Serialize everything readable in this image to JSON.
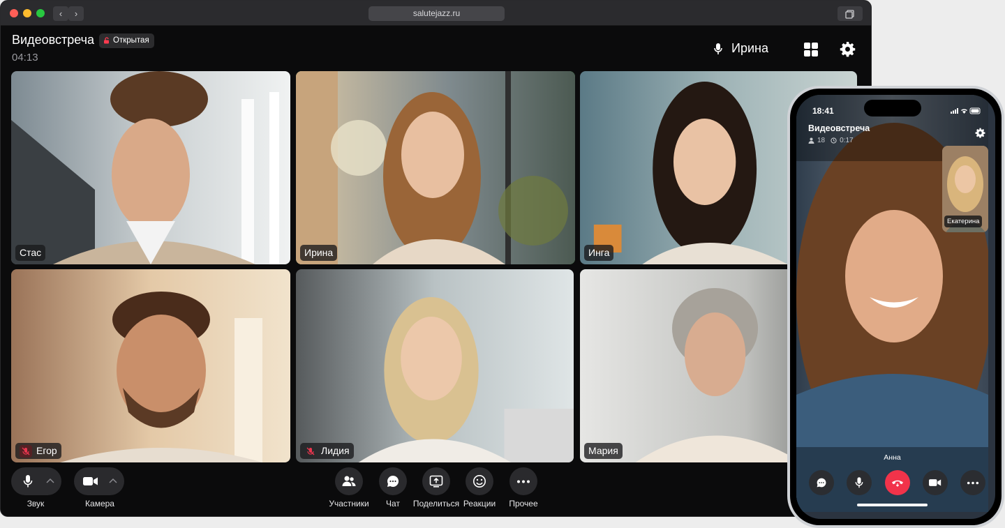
{
  "browser": {
    "url": "salutejazz.ru"
  },
  "meeting": {
    "title": "Видеовстреча",
    "access_badge": "Открытая",
    "timer": "04:13",
    "current_speaker": "Ирина"
  },
  "participants": [
    {
      "name": "Стас",
      "muted": false,
      "active": false
    },
    {
      "name": "Ирина",
      "muted": false,
      "active": true
    },
    {
      "name": "Инга",
      "muted": false,
      "active": false
    },
    {
      "name": "Егор",
      "muted": true,
      "active": false
    },
    {
      "name": "Лидия",
      "muted": true,
      "active": false
    },
    {
      "name": "Мария",
      "muted": false,
      "active": false
    }
  ],
  "toolbar": {
    "sound_label": "Звук",
    "camera_label": "Камера",
    "participants_label": "Участники",
    "chat_label": "Чат",
    "share_label": "Поделиться",
    "reactions_label": "Реакции",
    "more_label": "Прочее"
  },
  "phone": {
    "time": "18:41",
    "title": "Видеовстреча",
    "participants_count": "18",
    "duration": "0:17",
    "pip_name": "Екатерина",
    "main_name": "Анна"
  },
  "colors": {
    "active_border": "#34c24a",
    "hangup": "#f2334a",
    "mute_red": "#e8364e"
  }
}
